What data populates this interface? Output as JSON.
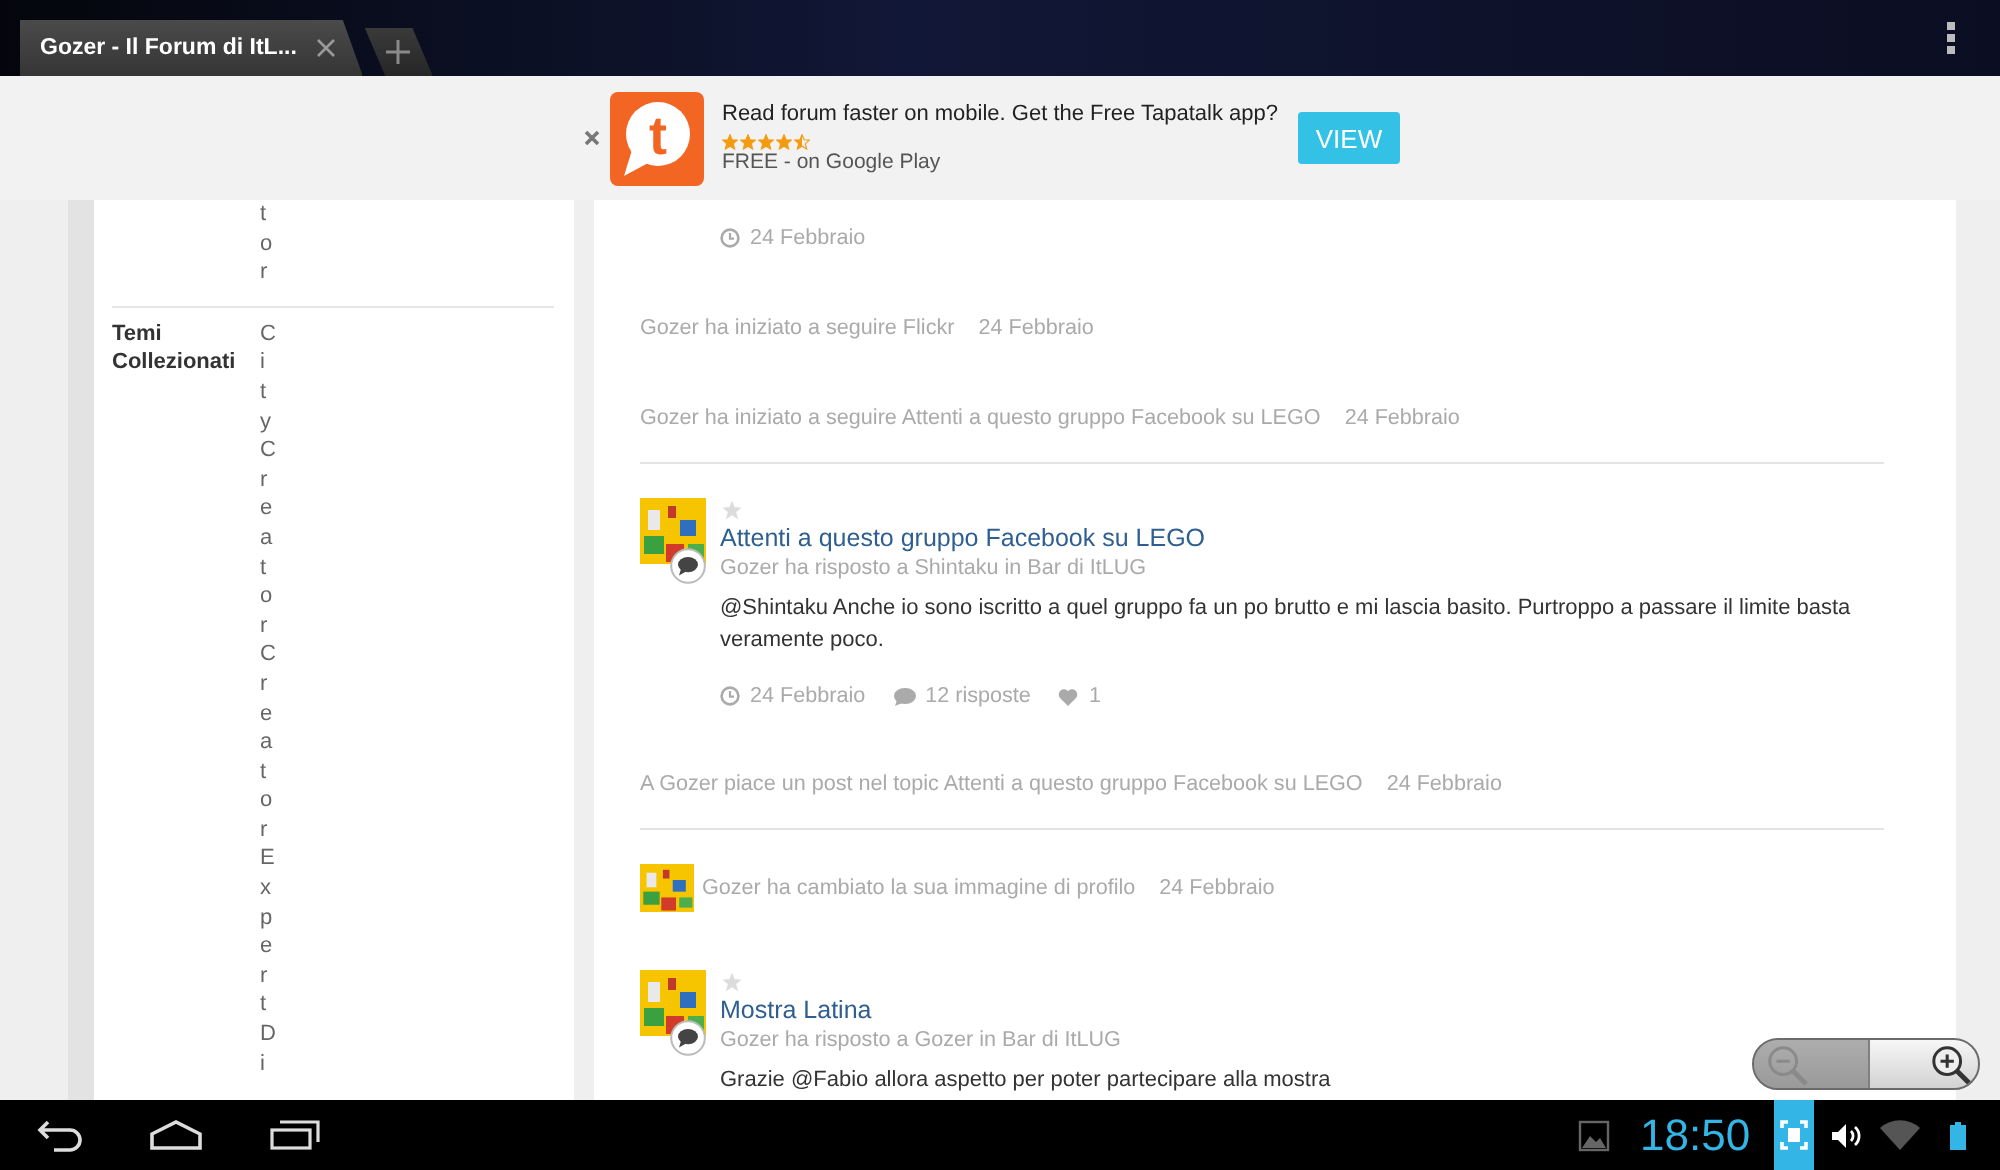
{
  "browser": {
    "tabs": [
      {
        "title": "Gozer - Il Forum di ItL...",
        "selected": true
      }
    ]
  },
  "app_banner": {
    "logo_letter": "t",
    "message": "Read forum faster on mobile. Get the Free Tapatalk app?",
    "stars": 4.5,
    "store_line": "FREE - on Google Play",
    "button": "VIEW"
  },
  "sidebar": {
    "fields": [
      {
        "value": "tor"
      },
      {
        "label": "Temi Collezionati",
        "value": "CityCreatorCreatorExpertDi"
      }
    ]
  },
  "feed": {
    "groups": [
      [
        {
          "kind": "meta",
          "date": "24 Febbraio"
        },
        {
          "kind": "activity",
          "avatar": false,
          "text": "Gozer ha iniziato a seguire Flickr",
          "date": "24 Febbraio"
        },
        {
          "kind": "activity",
          "avatar": false,
          "text": "Gozer ha iniziato a seguire Attenti a questo gruppo Facebook su LEGO",
          "date": "24 Febbraio"
        }
      ],
      [
        {
          "kind": "post",
          "starred": false,
          "title": "Attenti a questo gruppo Facebook su LEGO",
          "subtitle": "Gozer ha risposto a Shintaku in Bar di ItLUG",
          "body": "@Shintaku Anche io sono iscritto a quel gruppo fa un po brutto e mi lascia basito. Purtroppo a passare il limite basta veramente poco.",
          "date": "24 Febbraio",
          "replies": "12 risposte",
          "likes": "1"
        },
        {
          "kind": "activity",
          "avatar": false,
          "text": "A Gozer piace un post nel topic Attenti a questo gruppo Facebook su LEGO",
          "date": "24 Febbraio"
        }
      ],
      [
        {
          "kind": "activity",
          "avatar": true,
          "text": "Gozer ha cambiato la sua immagine di profilo",
          "date": "24 Febbraio"
        },
        {
          "kind": "post",
          "starred": false,
          "title": "Mostra Latina",
          "subtitle": "Gozer ha risposto a Gozer in Bar di ItLUG",
          "body": "Grazie @Fabio allora aspetto per poter partecipare alla mostra"
        }
      ]
    ]
  },
  "status_bar": {
    "time": "18:50"
  }
}
